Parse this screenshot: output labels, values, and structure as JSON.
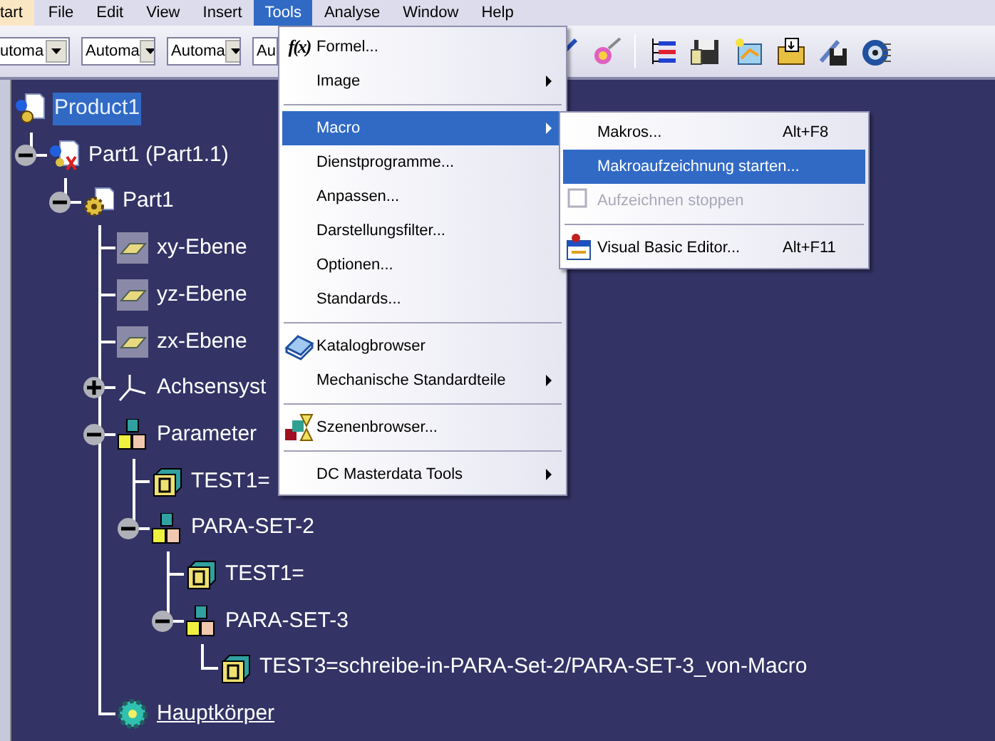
{
  "menubar": [
    {
      "label": "tart",
      "kind": "start",
      "selected": false
    },
    {
      "label": "File",
      "kind": "menu",
      "selected": false
    },
    {
      "label": "Edit",
      "kind": "menu",
      "selected": false
    },
    {
      "label": "View",
      "kind": "menu",
      "selected": false
    },
    {
      "label": "Insert",
      "kind": "menu",
      "selected": false
    },
    {
      "label": "Tools",
      "kind": "menu",
      "selected": true
    },
    {
      "label": "Analyse",
      "kind": "menu",
      "selected": false
    },
    {
      "label": "Window",
      "kind": "menu",
      "selected": false
    },
    {
      "label": "Help",
      "kind": "menu",
      "selected": false
    }
  ],
  "toolbar": {
    "combos": [
      {
        "value": "utoma"
      },
      {
        "value": "Automa"
      },
      {
        "value": "Automa"
      },
      {
        "value": "Au"
      }
    ]
  },
  "tools_menu": [
    {
      "kind": "formula",
      "label": "Formel...",
      "icon_text": "f(x)",
      "submenu": false,
      "selected": false
    },
    {
      "kind": "item",
      "label": "Image",
      "submenu": true,
      "selected": false
    },
    {
      "kind": "separator"
    },
    {
      "kind": "item",
      "label": "Macro",
      "submenu": true,
      "selected": true
    },
    {
      "kind": "item",
      "label": "Dienstprogramme...",
      "submenu": false,
      "selected": false
    },
    {
      "kind": "item",
      "label": "Anpassen...",
      "submenu": false,
      "selected": false
    },
    {
      "kind": "item",
      "label": "Darstellungsfilter...",
      "submenu": false,
      "selected": false
    },
    {
      "kind": "item",
      "label": "Optionen...",
      "submenu": false,
      "selected": false
    },
    {
      "kind": "item",
      "label": "Standards...",
      "submenu": false,
      "selected": false
    },
    {
      "kind": "separator"
    },
    {
      "kind": "catalog",
      "label": "Katalogbrowser",
      "submenu": false,
      "selected": false
    },
    {
      "kind": "item",
      "label": "Mechanische Standardteile",
      "submenu": true,
      "selected": false
    },
    {
      "kind": "separator"
    },
    {
      "kind": "scene",
      "label": "Szenenbrowser...",
      "submenu": false,
      "selected": false
    },
    {
      "kind": "separator"
    },
    {
      "kind": "item",
      "label": "DC Masterdata Tools",
      "submenu": true,
      "selected": false
    }
  ],
  "macro_submenu": [
    {
      "kind": "item",
      "label": "Makros...",
      "shortcut": "Alt+F8",
      "selected": false,
      "disabled": false
    },
    {
      "kind": "item",
      "label": "Makroaufzeichnung starten...",
      "selected": true,
      "disabled": false
    },
    {
      "kind": "check",
      "label": "Aufzeichnen stoppen",
      "selected": false,
      "disabled": true
    },
    {
      "kind": "separator"
    },
    {
      "kind": "editor",
      "label": "Visual Basic Editor...",
      "shortcut": "Alt+F11",
      "selected": false,
      "disabled": false
    }
  ],
  "tree": [
    {
      "label": "Product1",
      "kind": "product",
      "selected": true,
      "in_work": false,
      "children": [
        {
          "label": "Part1 (Part1.1)",
          "kind": "part-instance",
          "expanded": true,
          "selected": false,
          "in_work": false,
          "children": [
            {
              "label": "Part1",
              "kind": "part",
              "expanded": true,
              "selected": false,
              "in_work": false,
              "children": [
                {
                  "label": "xy-Ebene",
                  "kind": "plane",
                  "selected": false,
                  "in_work": false
                },
                {
                  "label": "yz-Ebene",
                  "kind": "plane",
                  "selected": false,
                  "in_work": false
                },
                {
                  "label": "zx-Ebene",
                  "kind": "plane",
                  "selected": false,
                  "in_work": false
                },
                {
                  "label": "Achsensyst",
                  "kind": "axis",
                  "expanded": false,
                  "selected": false,
                  "in_work": false
                },
                {
                  "label": "Parameter",
                  "kind": "parameter-set",
                  "expanded": true,
                  "selected": false,
                  "in_work": false,
                  "children": [
                    {
                      "label": "TEST1=",
                      "kind": "parameter",
                      "selected": false,
                      "in_work": false
                    },
                    {
                      "label": "PARA-SET-2",
                      "kind": "parameter-set",
                      "expanded": true,
                      "selected": false,
                      "in_work": false,
                      "children": [
                        {
                          "label": "TEST1=",
                          "kind": "parameter",
                          "selected": false,
                          "in_work": false
                        },
                        {
                          "label": "PARA-SET-3",
                          "kind": "parameter-set",
                          "expanded": true,
                          "selected": false,
                          "in_work": false,
                          "children": [
                            {
                              "label": "TEST3=schreibe-in-PARA-Set-2/PARA-SET-3_von-Macro",
                              "kind": "parameter",
                              "selected": false,
                              "in_work": false
                            }
                          ]
                        }
                      ]
                    }
                  ]
                },
                {
                  "label": "Hauptkörper",
                  "kind": "body",
                  "selected": false,
                  "in_work": true
                }
              ]
            }
          ]
        }
      ]
    }
  ]
}
